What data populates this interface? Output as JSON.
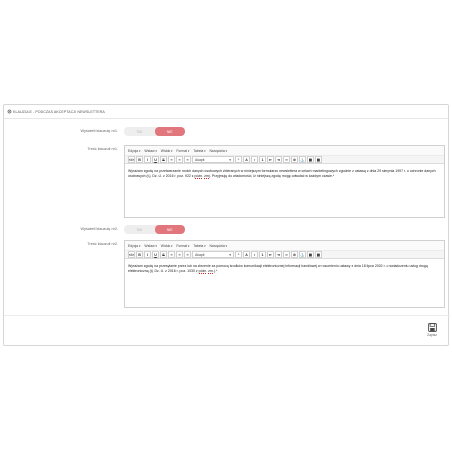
{
  "panel": {
    "title": "KLAUZULE - PODCZAS AKCEPTACJI NEWSLETTERA"
  },
  "clauses": [
    {
      "show_label": "Wyświetl klauzulę nr1.",
      "toggle": {
        "off": "TAK",
        "on": "NIE"
      },
      "content_label": "Treść klauzuli nr1.",
      "menu": [
        "Edycja",
        "Wstaw",
        "Widok",
        "Format",
        "Tabela",
        "Narzędzia"
      ],
      "format_select": "Akapit",
      "text_before": "Wyrażam zgodę na przetwarzanie moich danych osobowych zbieranych w niniejszym formularzu newslettera w celach marketingowych zgodnie z ustawą z dnia 29 sierpnia 1997 r. o ochronie danych osobowych (t.j. Dz. U. z 2016 r. poz. 922 z ",
      "spell1": "późn",
      "mid": ". ",
      "spell2": "zm",
      "text_after": "). Przyjmuję do wiadomości, iż niniejszą zgodę mogę odwołać w każdym czasie.*"
    },
    {
      "show_label": "Wyświetl klauzulę nr2.",
      "toggle": {
        "off": "TAK",
        "on": "NIE"
      },
      "content_label": "Treść klauzuli nr2.",
      "menu": [
        "Edycja",
        "Wstaw",
        "Widok",
        "Format",
        "Tabela",
        "Narzędzia"
      ],
      "format_select": "Akapit",
      "text_before": "Wyrażam zgodę na przesyłanie przez lub na zlecenie za pomocą środków komunikacji elektronicznej informacji handlowej w rozumieniu ustawy z dnia 18 lipca 2002 r. o świadczeniu usług drogą elektroniczną (tj. Dz. U. z 2016 r. poz. 1030 z ",
      "spell1": "późn",
      "mid": ". ",
      "spell2": "zm",
      "text_after": ".).*"
    }
  ],
  "save_label": "Zapisz",
  "colors": {
    "accent": "#e2767d",
    "border": "#d6d6d6"
  },
  "icons": [
    "cog-icon",
    "save-icon"
  ]
}
